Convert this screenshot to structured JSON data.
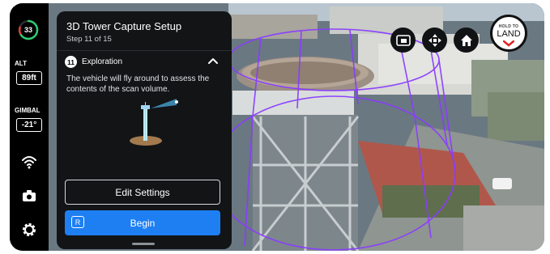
{
  "telemetry": {
    "battery": "33",
    "alt_label": "ALT",
    "alt_value": "89ft",
    "gimbal_label": "GIMBAL",
    "gimbal_value": "-21°"
  },
  "panel": {
    "title": "3D Tower Capture Setup",
    "step": "Step 11 of 15",
    "section_number": "11",
    "section_title": "Exploration",
    "description": "The vehicle will fly around to assess the contents of the scan volume.",
    "edit_button": "Edit Settings",
    "begin_key": "R",
    "begin_button": "Begin"
  },
  "land": {
    "hold_label": "HOLD TO",
    "land_label": "LAND"
  },
  "colors": {
    "accent": "#1e7ff3",
    "battery_ring": "#2ecc71",
    "land_red": "#e02424",
    "scan_volume": "#8a3cff"
  },
  "icons": [
    "battery-ring-icon",
    "wifi-icon",
    "camera-icon",
    "settings-gear-icon",
    "chevron-up-icon",
    "picture-in-picture-icon",
    "dpad-icon",
    "home-icon",
    "land-chevron-icon"
  ]
}
